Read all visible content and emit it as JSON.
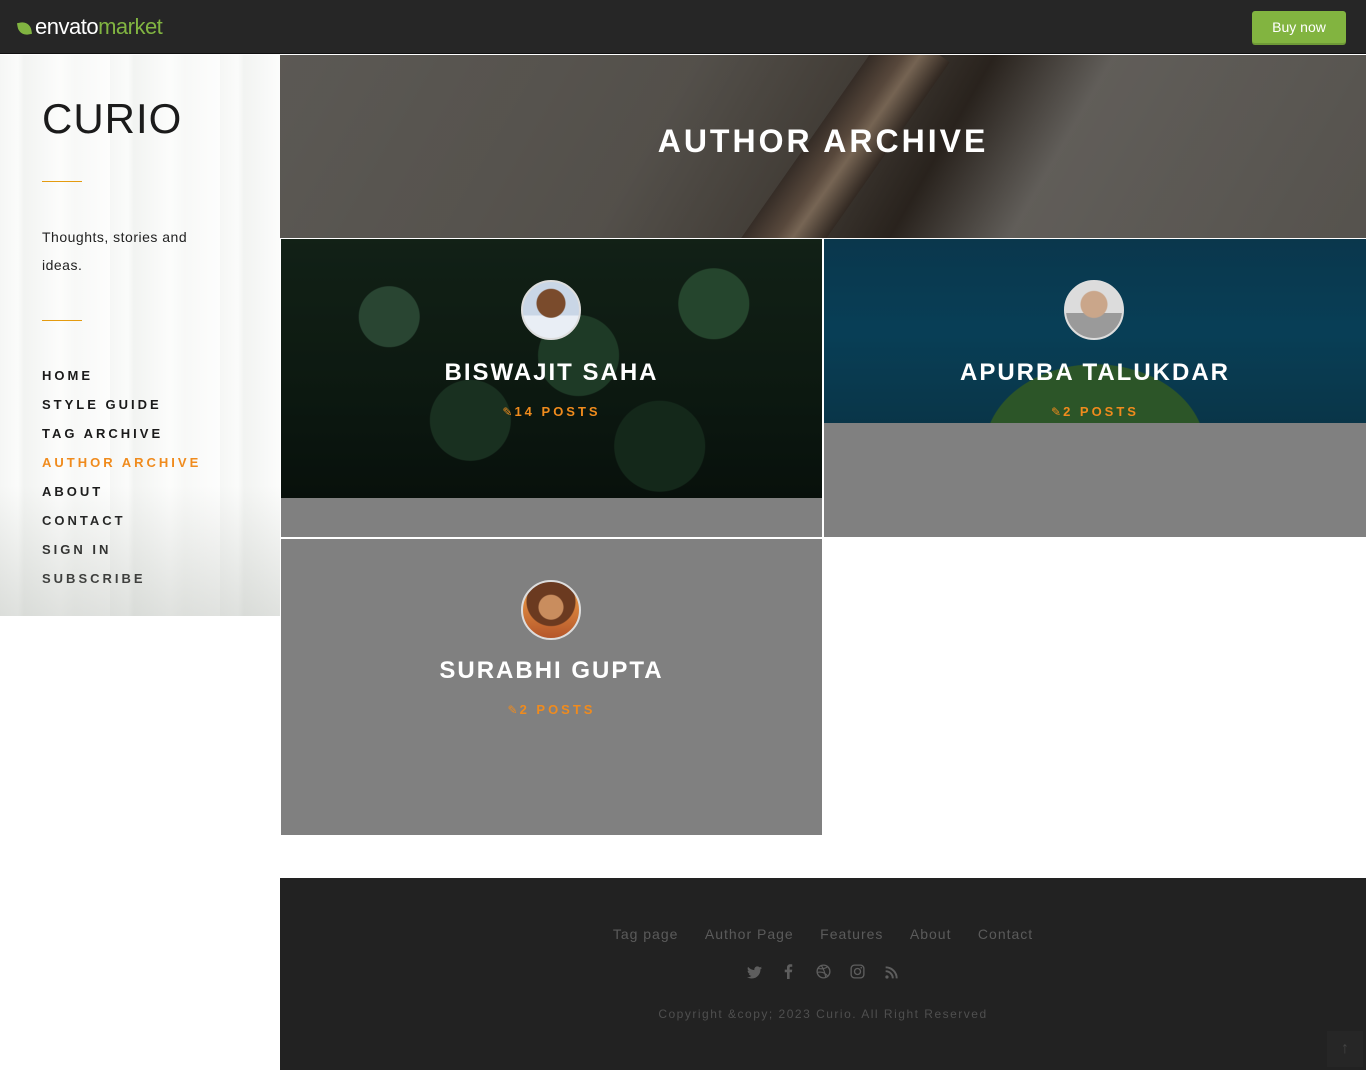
{
  "topbar": {
    "logo_envato": "envato",
    "logo_market": "market",
    "buy_label": "Buy now",
    "accent_color": "#82b440"
  },
  "sidebar": {
    "title": "CURIO",
    "tagline": "Thoughts, stories and ideas.",
    "nav": [
      {
        "label": "HOME",
        "active": false
      },
      {
        "label": "STYLE GUIDE",
        "active": false
      },
      {
        "label": "TAG ARCHIVE",
        "active": false
      },
      {
        "label": "AUTHOR ARCHIVE",
        "active": true
      },
      {
        "label": "ABOUT",
        "active": false
      },
      {
        "label": "CONTACT",
        "active": false
      },
      {
        "label": "SIGN IN",
        "active": false
      },
      {
        "label": "SUBSCRIBE",
        "active": false
      }
    ],
    "accent_color": "#f08b1d"
  },
  "hero": {
    "title": "AUTHOR ARCHIVE"
  },
  "authors": [
    {
      "name": "BISWAJIT SAHA",
      "posts": "14 POSTS"
    },
    {
      "name": "APURBA TALUKDAR",
      "posts": "2 POSTS"
    },
    {
      "name": "SURABHI GUPTA",
      "posts": "2 POSTS"
    }
  ],
  "footer": {
    "links": [
      "Tag page",
      "Author Page",
      "Features",
      "About",
      "Contact"
    ],
    "social_icons": [
      "twitter-icon",
      "facebook-icon",
      "dribbble-icon",
      "instagram-icon",
      "rss-icon"
    ],
    "copyright": "Copyright &copy; 2023 Curio. All Right Reserved",
    "back_to_top": "↑"
  }
}
